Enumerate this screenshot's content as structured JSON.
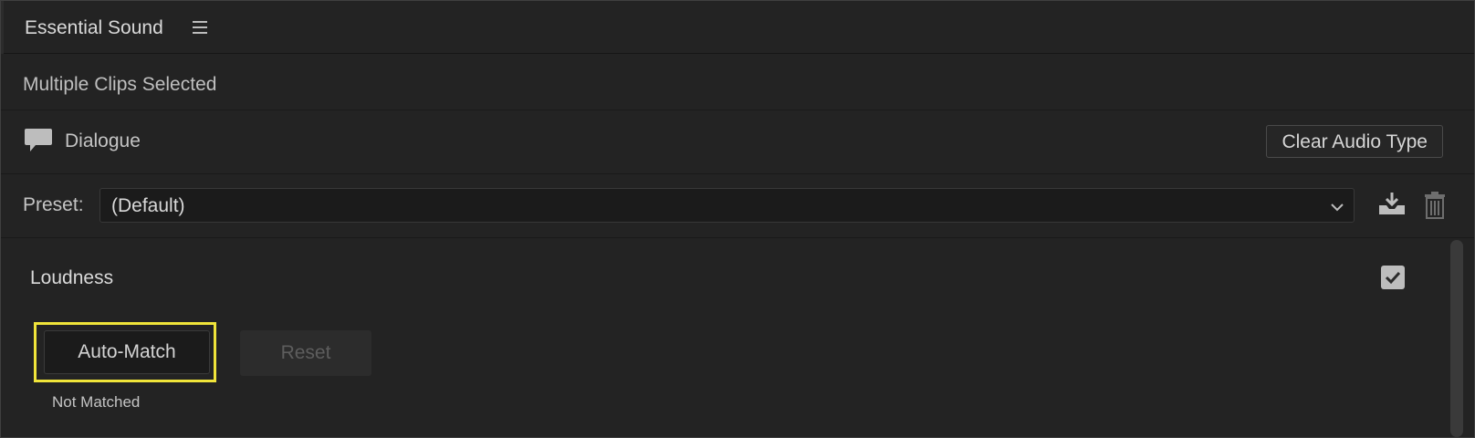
{
  "panel": {
    "title": "Essential Sound"
  },
  "selection": {
    "text": "Multiple Clips Selected"
  },
  "audio_type": {
    "label": "Dialogue",
    "icon": "speech-bubble-icon",
    "clear_label": "Clear Audio Type"
  },
  "preset": {
    "label": "Preset:",
    "value": "(Default)"
  },
  "loudness": {
    "title": "Loudness",
    "enabled": true,
    "auto_match_label": "Auto-Match",
    "reset_label": "Reset",
    "status": "Not Matched"
  },
  "colors": {
    "highlight": "#f0e43a",
    "background": "#232323"
  }
}
